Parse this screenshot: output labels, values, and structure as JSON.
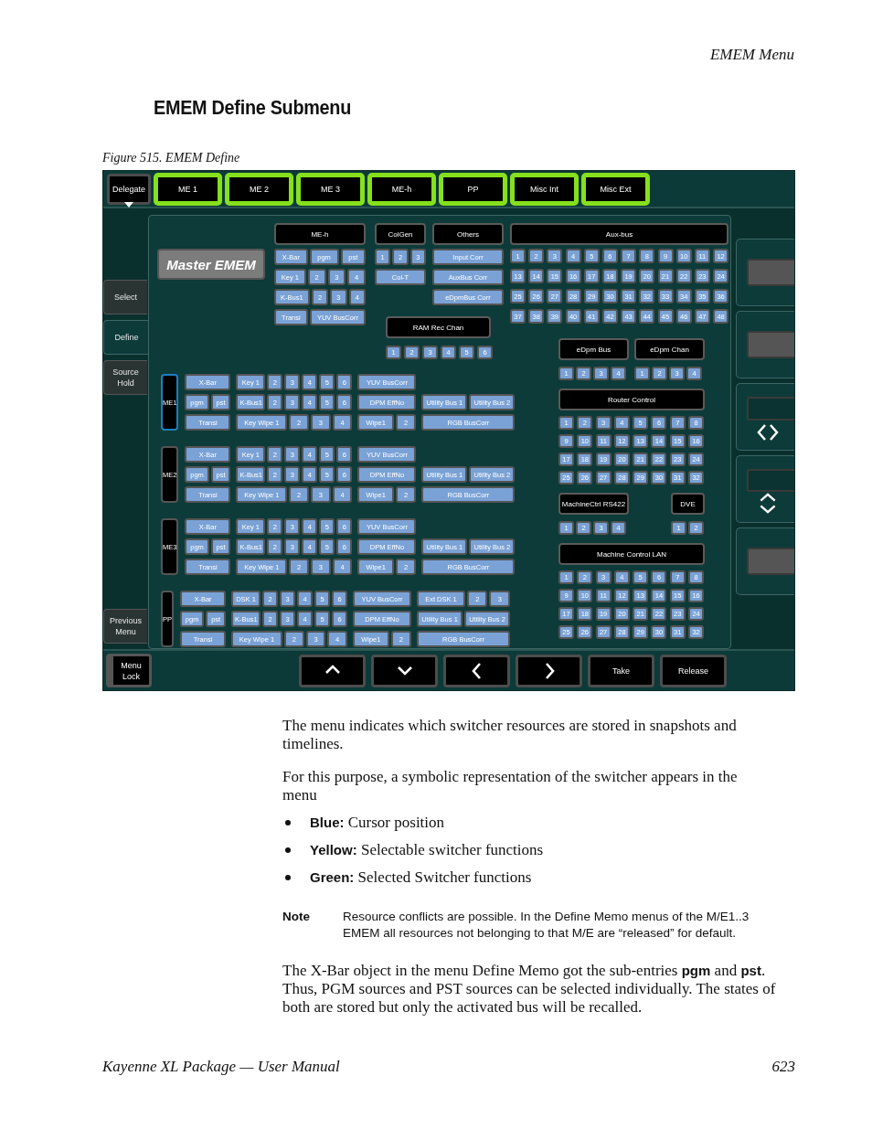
{
  "page_header": "EMEM Menu",
  "heading": "EMEM Define Submenu",
  "figure_caption": "Figure 515.  EMEM Define",
  "screen": {
    "delegate": "Delegate",
    "tabs": [
      "ME 1",
      "ME 2",
      "ME 3",
      "ME-h",
      "PP",
      "Misc Int",
      "Misc Ext"
    ],
    "side_menu": [
      {
        "label": "Select",
        "selected": false
      },
      {
        "label": "Define",
        "selected": true
      },
      {
        "label": "Source Hold",
        "selected": false
      },
      {
        "label": "Previous Menu",
        "selected": false
      }
    ],
    "master_button": "Master EMEM",
    "me_h": {
      "label": "ME-h",
      "rows": [
        [
          "X-Bar",
          "pgm",
          "pst"
        ],
        [
          "Key 1",
          "2",
          "3",
          "4"
        ],
        [
          "K-Bus1",
          "2",
          "3",
          "4"
        ],
        [
          "Transi",
          "YUV BusCorr"
        ]
      ]
    },
    "colgen": {
      "label": "ColGen",
      "buttons": [
        "1",
        "2",
        "3"
      ],
      "wide_button": "Col-T"
    },
    "others": {
      "label": "Others",
      "rows": [
        [
          "Input Corr"
        ],
        [
          "AuxBus Corr"
        ],
        [
          "eDpmBus Corr"
        ]
      ]
    },
    "ram_rec": {
      "label": "RAM Rec Chan",
      "buttons": [
        "1",
        "2",
        "3",
        "4",
        "5",
        "6"
      ]
    },
    "aux_bus": {
      "label": "Aux-bus",
      "rows": [
        [
          "1",
          "2",
          "3",
          "4",
          "5",
          "6",
          "7",
          "8",
          "9",
          "10",
          "11",
          "12"
        ],
        [
          "13",
          "14",
          "15",
          "16",
          "17",
          "18",
          "19",
          "20",
          "21",
          "22",
          "23",
          "24"
        ],
        [
          "25",
          "26",
          "27",
          "28",
          "29",
          "30",
          "31",
          "32",
          "33",
          "34",
          "35",
          "36"
        ],
        [
          "37",
          "38",
          "39",
          "40",
          "41",
          "42",
          "43",
          "44",
          "45",
          "46",
          "47",
          "48"
        ]
      ]
    },
    "me_blocks": [
      {
        "label": "ME1",
        "cursor": true,
        "rows": [
          [
            [
              "X-Bar"
            ],
            [
              "Key 1",
              "2",
              "3",
              "4",
              "5",
              "6"
            ],
            [
              "YUV BusCorr"
            ]
          ],
          [
            [
              "pgm",
              "pst"
            ],
            [
              "K-Bus1",
              "2",
              "3",
              "4",
              "5",
              "6"
            ],
            [
              "DPM EffNo"
            ],
            [
              "Utility Bus 1",
              "Utility Bus 2"
            ]
          ],
          [
            [
              "Transi"
            ],
            [
              "Key Wipe 1",
              "2",
              "3",
              "4"
            ],
            [
              "Wipe1",
              "2"
            ],
            [
              "RGB BusCorr"
            ]
          ]
        ]
      },
      {
        "label": "ME2",
        "cursor": false,
        "rows": [
          [
            [
              "X-Bar"
            ],
            [
              "Key 1",
              "2",
              "3",
              "4",
              "5",
              "6"
            ],
            [
              "YUV BusCorr"
            ]
          ],
          [
            [
              "pgm",
              "pst"
            ],
            [
              "K-Bus1",
              "2",
              "3",
              "4",
              "5",
              "6"
            ],
            [
              "DPM EffNo"
            ],
            [
              "Utility Bus 1",
              "Utility Bus 2"
            ]
          ],
          [
            [
              "Transi"
            ],
            [
              "Key Wipe 1",
              "2",
              "3",
              "4"
            ],
            [
              "Wipe1",
              "2"
            ],
            [
              "RGB BusCorr"
            ]
          ]
        ]
      },
      {
        "label": "ME3",
        "cursor": false,
        "rows": [
          [
            [
              "X-Bar"
            ],
            [
              "Key 1",
              "2",
              "3",
              "4",
              "5",
              "6"
            ],
            [
              "YUV BusCorr"
            ]
          ],
          [
            [
              "pgm",
              "pst"
            ],
            [
              "K-Bus1",
              "2",
              "3",
              "4",
              "5",
              "6"
            ],
            [
              "DPM EffNo"
            ],
            [
              "Utility Bus 1",
              "Utility Bus 2"
            ]
          ],
          [
            [
              "Transi"
            ],
            [
              "Key Wipe 1",
              "2",
              "3",
              "4"
            ],
            [
              "Wipe1",
              "2"
            ],
            [
              "RGB BusCorr"
            ]
          ]
        ]
      },
      {
        "label": "PP",
        "cursor": false,
        "rows": [
          [
            [
              "X-Bar"
            ],
            [
              "DSK 1",
              "2",
              "3",
              "4",
              "5",
              "6"
            ],
            [
              "YUV BusCorr"
            ],
            [
              "Ext DSK 1",
              "2",
              "3"
            ]
          ],
          [
            [
              "pgm",
              "pst"
            ],
            [
              "K-Bus1",
              "2",
              "3",
              "4",
              "5",
              "6"
            ],
            [
              "DPM EffNo"
            ],
            [
              "Utility Bus 1",
              "Utility Bus 2"
            ]
          ],
          [
            [
              "Transi"
            ],
            [
              "Key Wipe 1",
              "2",
              "3",
              "4"
            ],
            [
              "Wipe1",
              "2"
            ],
            [
              "RGB BusCorr"
            ]
          ]
        ]
      }
    ],
    "channel_blocks": [
      {
        "kind": "split",
        "parts": [
          {
            "label": "eDpm Bus",
            "buttons": [
              "1",
              "2",
              "3",
              "4"
            ]
          },
          {
            "label": "eDpm Chan",
            "buttons": [
              "1",
              "2",
              "3",
              "4"
            ]
          }
        ]
      },
      {
        "kind": "grid",
        "label": "Router Control",
        "rows": [
          [
            "1",
            "2",
            "3",
            "4",
            "5",
            "6",
            "7",
            "8"
          ],
          [
            "9",
            "10",
            "11",
            "12",
            "13",
            "14",
            "15",
            "16"
          ],
          [
            "17",
            "18",
            "19",
            "20",
            "21",
            "22",
            "23",
            "24"
          ],
          [
            "25",
            "26",
            "27",
            "28",
            "29",
            "30",
            "31",
            "32"
          ]
        ]
      },
      {
        "kind": "split",
        "parts": [
          {
            "label": "MachineCtrl RS422",
            "buttons": [
              "1",
              "2",
              "3",
              "4"
            ]
          },
          {
            "label": "DVE",
            "buttons": [
              "1",
              "2"
            ]
          }
        ]
      },
      {
        "kind": "grid",
        "label": "Machine Control LAN",
        "rows": [
          [
            "1",
            "2",
            "3",
            "4",
            "5",
            "6",
            "7",
            "8"
          ],
          [
            "9",
            "10",
            "11",
            "12",
            "13",
            "14",
            "15",
            "16"
          ],
          [
            "17",
            "18",
            "19",
            "20",
            "21",
            "22",
            "23",
            "24"
          ],
          [
            "25",
            "26",
            "27",
            "28",
            "29",
            "30",
            "31",
            "32"
          ]
        ]
      }
    ],
    "right_panels": [
      {
        "kind": "slot"
      },
      {
        "kind": "slot"
      },
      {
        "kind": "horizontal"
      },
      {
        "kind": "vertical"
      },
      {
        "kind": "slot"
      }
    ],
    "menu_lock": "Menu Lock",
    "bottom_buttons": [
      {
        "kind": "up"
      },
      {
        "kind": "down"
      },
      {
        "kind": "left"
      },
      {
        "kind": "right"
      },
      {
        "kind": "text",
        "label": "Take"
      },
      {
        "kind": "text",
        "label": "Release"
      }
    ]
  },
  "paragraphs": [
    "The menu indicates which switcher resources are stored in snapshots and timelines.",
    "For this purpose, a symbolic representation of the switcher appears in the menu"
  ],
  "bullets": [
    "**Blue:** Cursor position",
    "**Yellow:** Selectable switcher functions",
    "**Green:** Selected Switcher functions"
  ],
  "note": {
    "label": "Note",
    "text": "Resource conflicts are possible. In the Define Memo menus of the M/E1..3 EMEM all resources not belonging to that M/E are “released” for default."
  },
  "closing_paragraph": "The X-Bar object in the menu Define Memo got the sub-entries **pgm** and **pst**. Thus, PGM sources and PST sources can be selected individually. The states of both are stored but only the activated bus will be recalled.",
  "footer": {
    "title": "Kayenne XL Package  —  User Manual",
    "page": "623"
  }
}
